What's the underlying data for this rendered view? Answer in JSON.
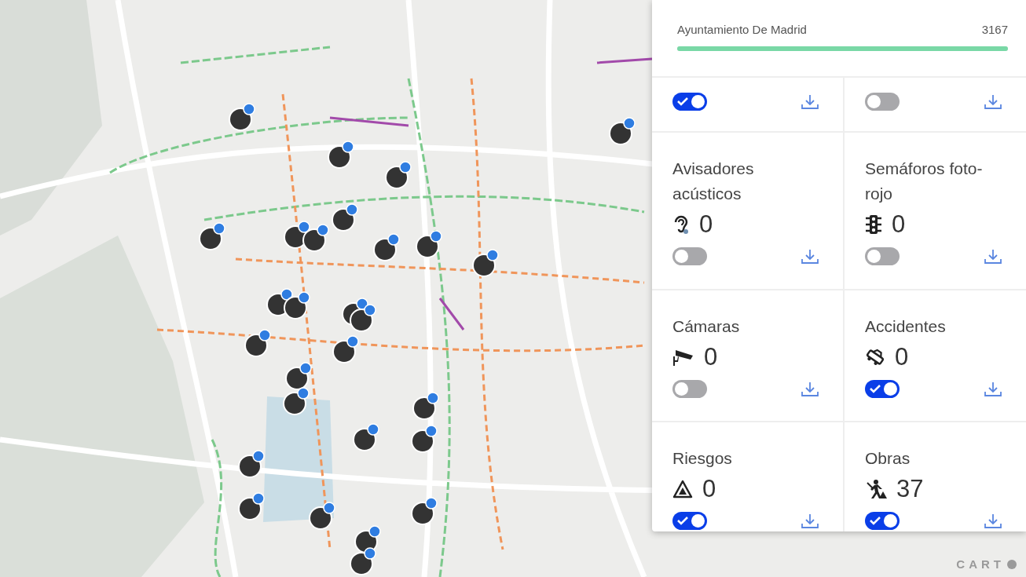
{
  "map": {
    "logo": "CART"
  },
  "panel": {
    "source": {
      "label": "Ayuntamiento De Madrid",
      "count": "3167",
      "level": 1
    },
    "layers": [
      {
        "on": true
      },
      {
        "on": false
      },
      {
        "title": "Avisadores acústicos",
        "kind": "ear",
        "count": "0",
        "on": false
      },
      {
        "title": "Semáforos foto-rojo",
        "kind": "traffic",
        "count": "0",
        "on": false
      },
      {
        "title": "Cámaras",
        "kind": "camera",
        "count": "0",
        "on": false
      },
      {
        "title": "Accidentes",
        "kind": "accident",
        "count": "0",
        "on": true
      },
      {
        "title": "Riesgos",
        "kind": "risk",
        "count": "0",
        "on": true
      },
      {
        "title": "Obras",
        "kind": "works",
        "count": "37",
        "on": true
      }
    ]
  }
}
